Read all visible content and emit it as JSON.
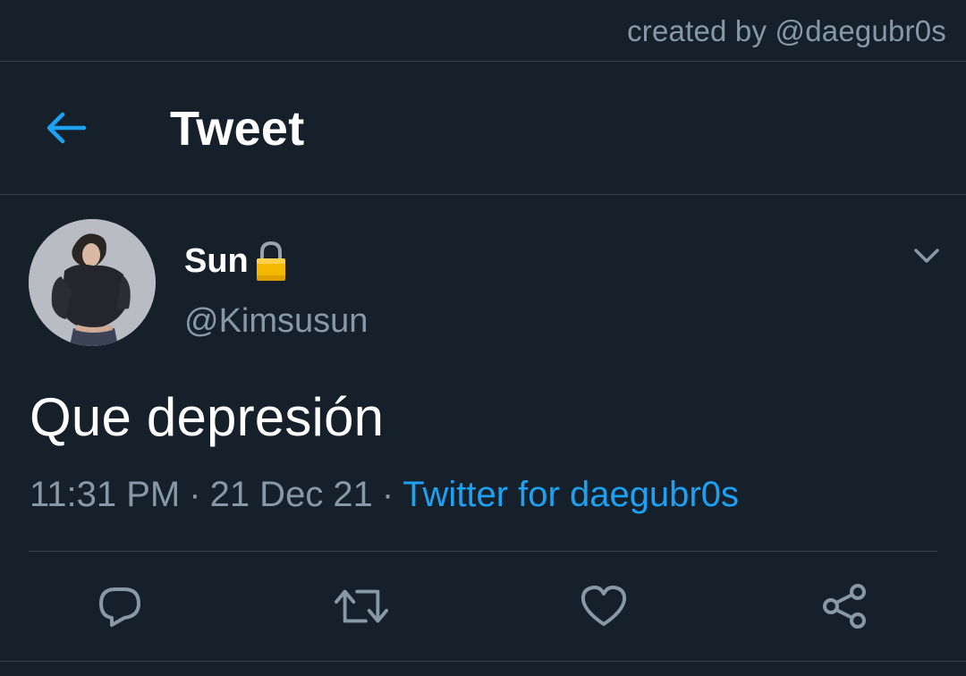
{
  "watermark": "created by @daegubr0s",
  "header": {
    "back_icon": "arrow-left-icon",
    "title": "Tweet"
  },
  "tweet": {
    "display_name": "Sun",
    "lock_icon": "lock-icon",
    "handle": "@Kimsusun",
    "text": "Que depresión",
    "time": "11:31 PM",
    "separator": "·",
    "date": "21 Dec 21",
    "client": "Twitter for daegubr0s"
  },
  "actions": {
    "reply_icon": "reply-icon",
    "retweet_icon": "retweet-icon",
    "like_icon": "heart-icon",
    "share_icon": "share-icon"
  },
  "colors": {
    "background": "#15202b",
    "accent": "#1da1f2",
    "secondary_text": "#8899a6",
    "divider": "#38444d"
  }
}
